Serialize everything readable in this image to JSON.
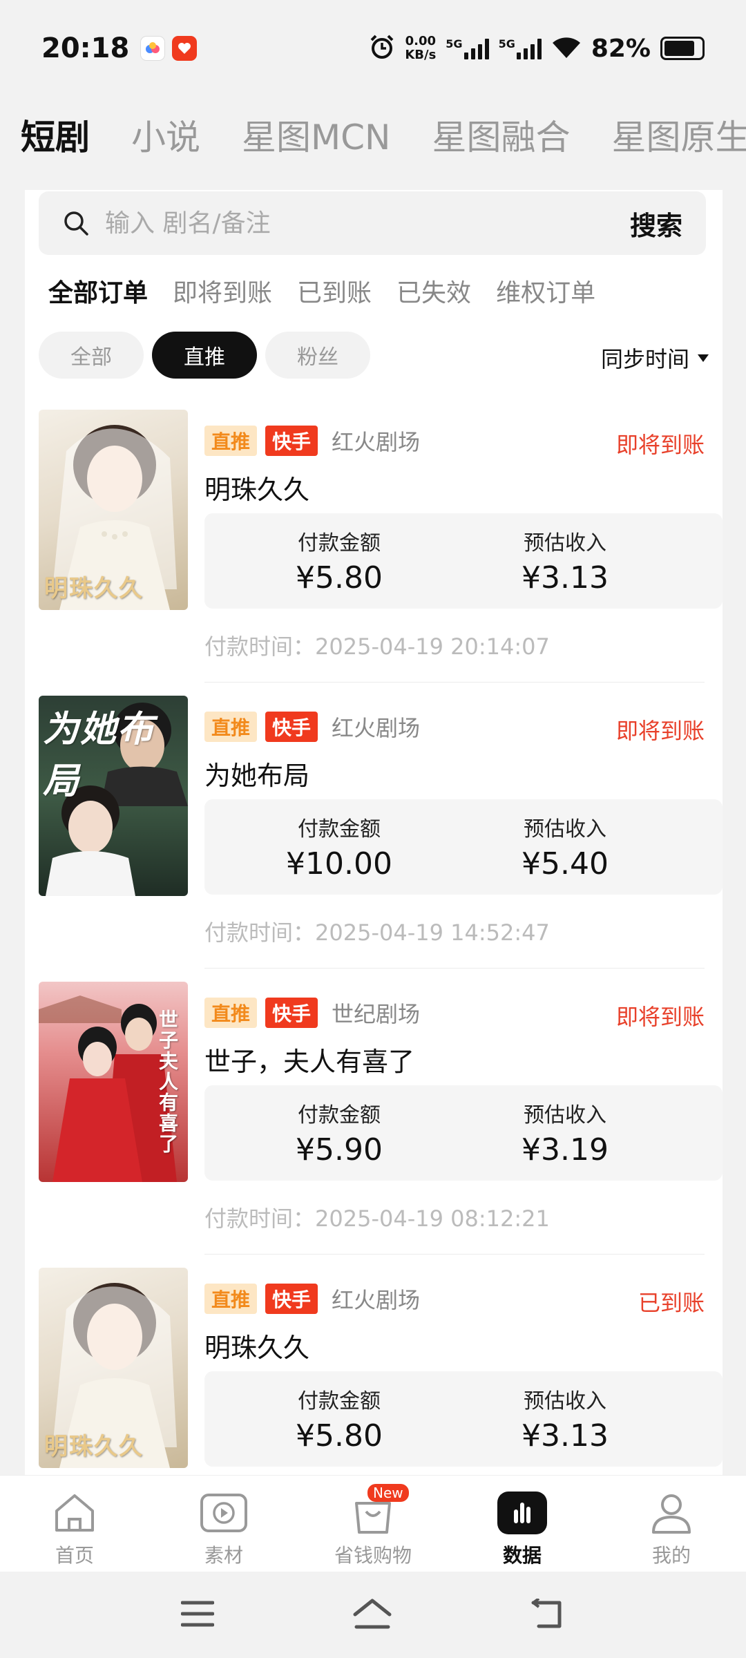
{
  "status_bar": {
    "time": "20:18",
    "net_speed_value": "0.00",
    "net_speed_unit": "KB/s",
    "sig1": "5G",
    "sig2": "5G",
    "battery_pct": "82%"
  },
  "top_tabs": [
    "短剧",
    "小说",
    "星图MCN",
    "星图融合",
    "星图原生"
  ],
  "search": {
    "placeholder": "输入 剧名/备注",
    "button": "搜索"
  },
  "status_tabs": [
    "全部订单",
    "即将到账",
    "已到账",
    "已失效",
    "维权订单"
  ],
  "chips": [
    "全部",
    "直推",
    "粉丝"
  ],
  "sync_label": "同步时间",
  "labels": {
    "pay_amount": "付款金额",
    "est_income": "预估收入",
    "pay_time_prefix": "付款时间："
  },
  "orders": [
    {
      "tag1": "直推",
      "tag2": "快手",
      "theater": "红火剧场",
      "status": "即将到账",
      "title": "明珠久久",
      "pay": "¥5.80",
      "income": "¥3.13",
      "time": "2025-04-19 20:14:07"
    },
    {
      "tag1": "直推",
      "tag2": "快手",
      "theater": "红火剧场",
      "status": "即将到账",
      "title": "为她布局",
      "pay": "¥10.00",
      "income": "¥5.40",
      "time": "2025-04-19 14:52:47"
    },
    {
      "tag1": "直推",
      "tag2": "快手",
      "theater": "世纪剧场",
      "status": "即将到账",
      "title": "世子，夫人有喜了",
      "pay": "¥5.90",
      "income": "¥3.19",
      "time": "2025-04-19 08:12:21"
    },
    {
      "tag1": "直推",
      "tag2": "快手",
      "theater": "红火剧场",
      "status": "已到账",
      "title": "明珠久久",
      "pay": "¥5.80",
      "income": "¥3.13",
      "time": ""
    }
  ],
  "posters": [
    {
      "caption": "明珠久久",
      "icon": "bride-portrait"
    },
    {
      "caption": "为她布局",
      "icon": "couple-portrait"
    },
    {
      "caption": "世子夫人有喜了",
      "icon": "red-costume-couple"
    },
    {
      "caption": "明珠久久",
      "icon": "bride-portrait"
    }
  ],
  "bottom_nav": [
    {
      "label": "首页",
      "icon": "home-icon"
    },
    {
      "label": "素材",
      "icon": "play-icon"
    },
    {
      "label": "省钱购物",
      "icon": "shopping-bag-icon",
      "badge": "New"
    },
    {
      "label": "数据",
      "icon": "bar-chart-icon"
    },
    {
      "label": "我的",
      "icon": "user-icon"
    }
  ],
  "colors": {
    "accent_red": "#e8402a",
    "tag_orange_bg": "#fde6c4",
    "tag_orange_fg": "#f28a1c",
    "kuaishou_red": "#f03a1e"
  }
}
